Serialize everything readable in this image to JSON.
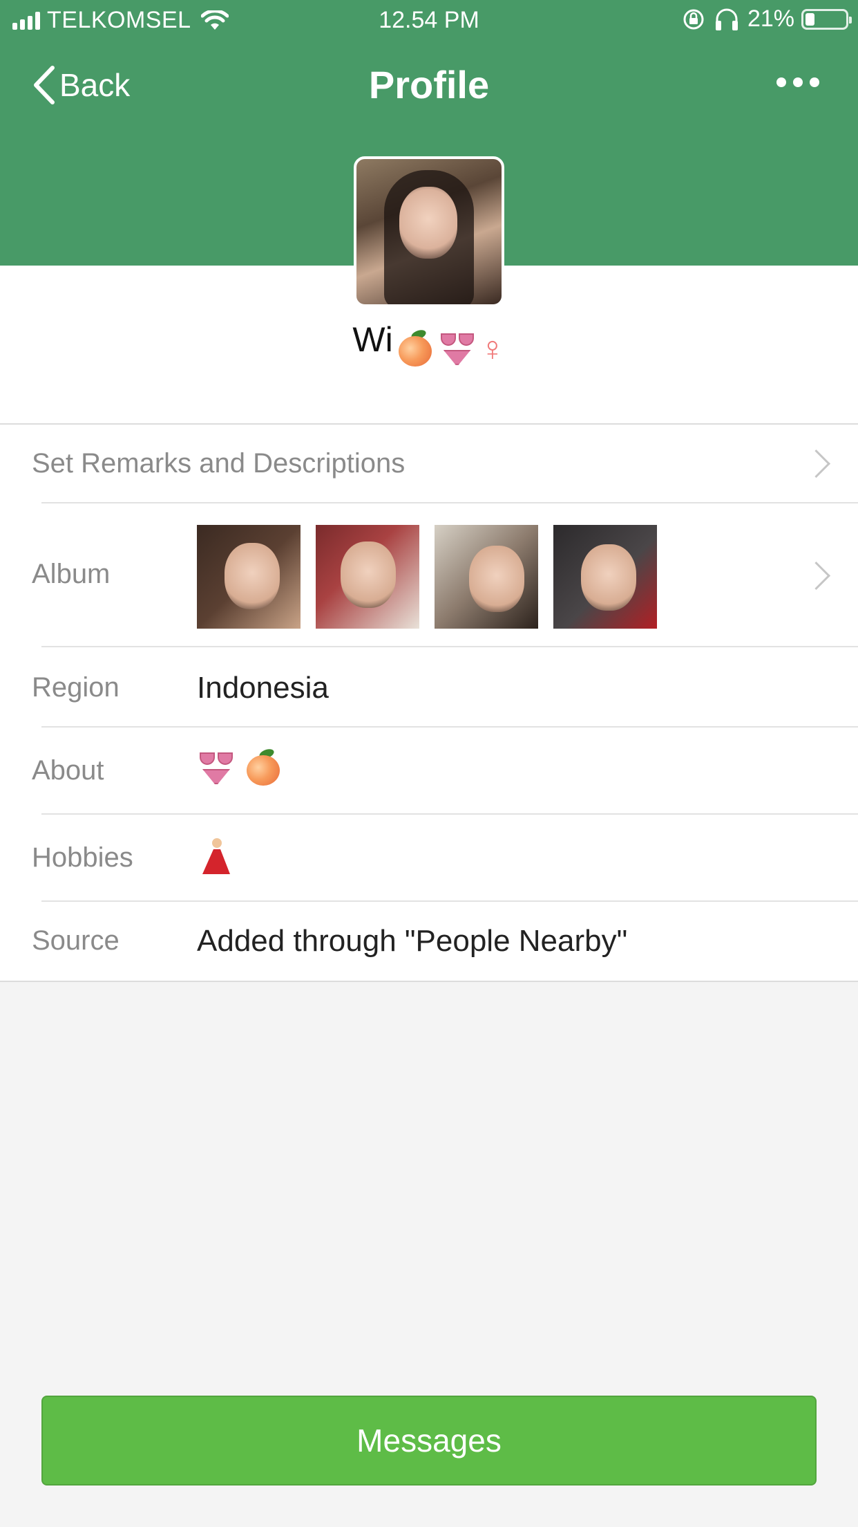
{
  "status_bar": {
    "carrier": "TELKOMSEL",
    "time": "12.54 PM",
    "battery_percent": "21%",
    "battery_level": 0.21,
    "signal_bars": 4
  },
  "nav": {
    "back_label": "Back",
    "title": "Profile",
    "more_icon": "more-icon"
  },
  "profile": {
    "name": "Wi",
    "name_emojis": [
      "peach-emoji",
      "bikini-emoji",
      "female-sign"
    ],
    "female_sign": "♀"
  },
  "rows": {
    "remarks": {
      "label": "Set Remarks and Descriptions"
    },
    "album": {
      "label": "Album",
      "photo_count": 4
    },
    "region": {
      "label": "Region",
      "value": "Indonesia"
    },
    "about": {
      "label": "About",
      "emojis": [
        "bikini-emoji",
        "peach-emoji"
      ]
    },
    "hobbies": {
      "label": "Hobbies",
      "emojis": [
        "dancer-emoji"
      ]
    },
    "source": {
      "label": "Source",
      "value": "Added through \"People Nearby\""
    }
  },
  "actions": {
    "messages_label": "Messages"
  },
  "colors": {
    "header_green": "#489a67",
    "button_green": "#5ebc47",
    "label_gray": "#8a8a8a",
    "background": "#f4f4f4"
  }
}
